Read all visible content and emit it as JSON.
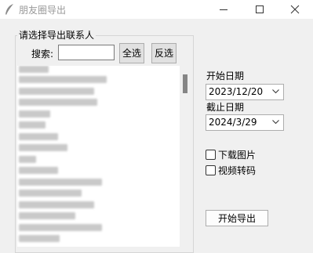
{
  "window": {
    "title": "朋友圈导出",
    "app_icon": "feather-icon"
  },
  "contacts": {
    "group_title": "请选择导出联系人",
    "search_label": "搜索:",
    "search_value": "",
    "select_all_label": "全选",
    "invert_label": "反选"
  },
  "dates": {
    "start_label": "开始日期",
    "start_value": "2023/12/20",
    "end_label": "截止日期",
    "end_value": "2024/3/29"
  },
  "options": {
    "download_images": {
      "label": "下载图片",
      "checked": false
    },
    "video_transcode": {
      "label": "视频转码",
      "checked": false
    }
  },
  "export_button_label": "开始导出"
}
